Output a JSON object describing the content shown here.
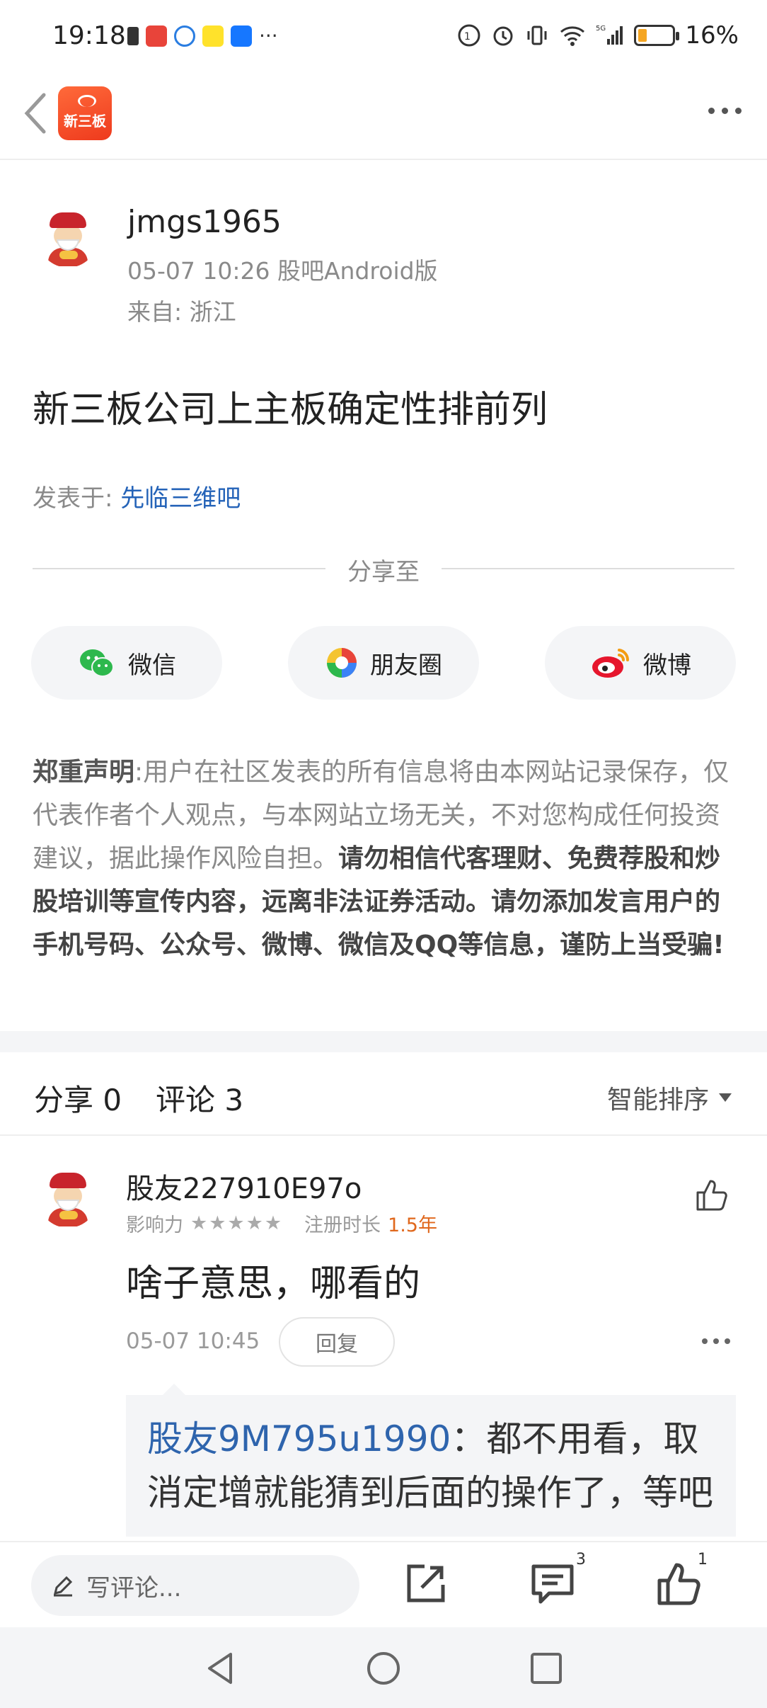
{
  "status_bar": {
    "time": "19:18",
    "battery_percent": "16%",
    "network": "5G"
  },
  "header": {
    "app_logo_text": "新三板"
  },
  "post": {
    "author": "jmgs1965",
    "meta": "05-07 10:26 股吧Android版",
    "location": "来自: 浙江",
    "title": "新三板公司上主板确定性排前列",
    "posted_in_label": "发表于:",
    "forum": "先临三维吧"
  },
  "share": {
    "label": "分享至",
    "wechat": "微信",
    "moments": "朋友圈",
    "weibo": "微博"
  },
  "disclaimer": {
    "heading": "郑重声明",
    "colon": ":",
    "normal": "用户在社区发表的所有信息将由本网站记录保存，仅代表作者个人观点，与本网站立场无关，不对您构成任何投资建议，据此操作风险自担。",
    "bold": "请勿相信代客理财、免费荐股和炒股培训等宣传内容，远离非法证券活动。请勿添加发言用户的手机号码、公众号、微博、微信及QQ等信息，谨防上当受骗!"
  },
  "tabs": {
    "share": "分享 0",
    "comment": "评论 3",
    "sort": "智能排序"
  },
  "comment": {
    "user": "股友227910E97o",
    "influence_label": "影响力",
    "stars": "★★★★★",
    "reg_label": "注册时长",
    "reg_years": "1.5年",
    "text": "啥子意思，哪看的",
    "time": "05-07 10:45",
    "reply_label": "回复",
    "reply": {
      "user": "股友9M795u1990",
      "text": "：都不用看，取消定增就能猜到后面的操作了，等吧"
    }
  },
  "action_bar": {
    "placeholder": "写评论...",
    "comment_count": "3",
    "like_count": "1"
  }
}
